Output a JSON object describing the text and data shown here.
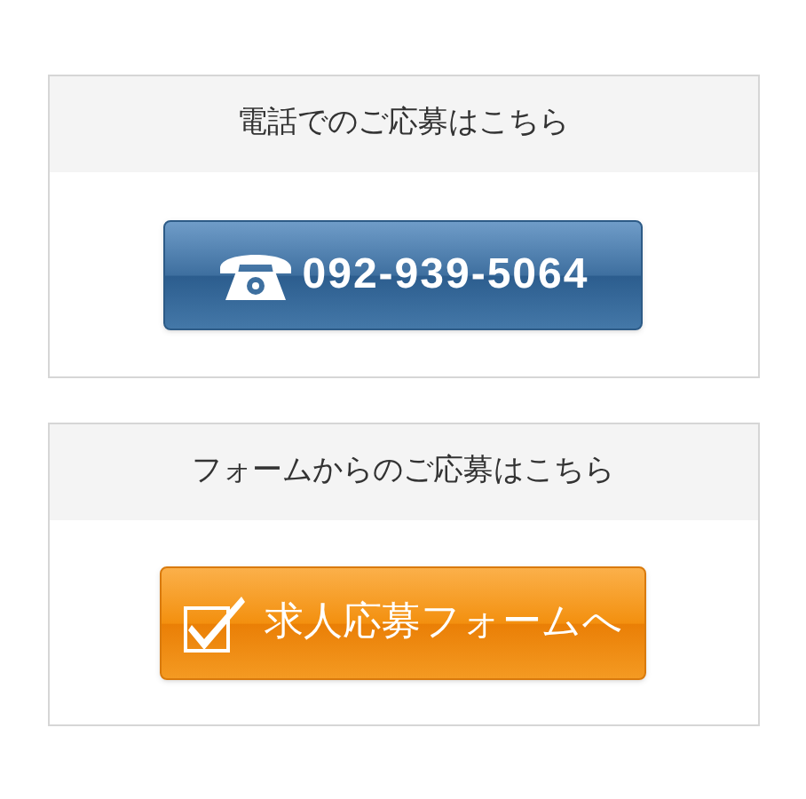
{
  "cards": [
    {
      "heading": "電話でのご応募はこちら",
      "button": {
        "kind": "phone",
        "label": "092-939-5064"
      }
    },
    {
      "heading": "フォームからのご応募はこちら",
      "button": {
        "kind": "form",
        "label": "求人応募フォームへ"
      }
    }
  ]
}
